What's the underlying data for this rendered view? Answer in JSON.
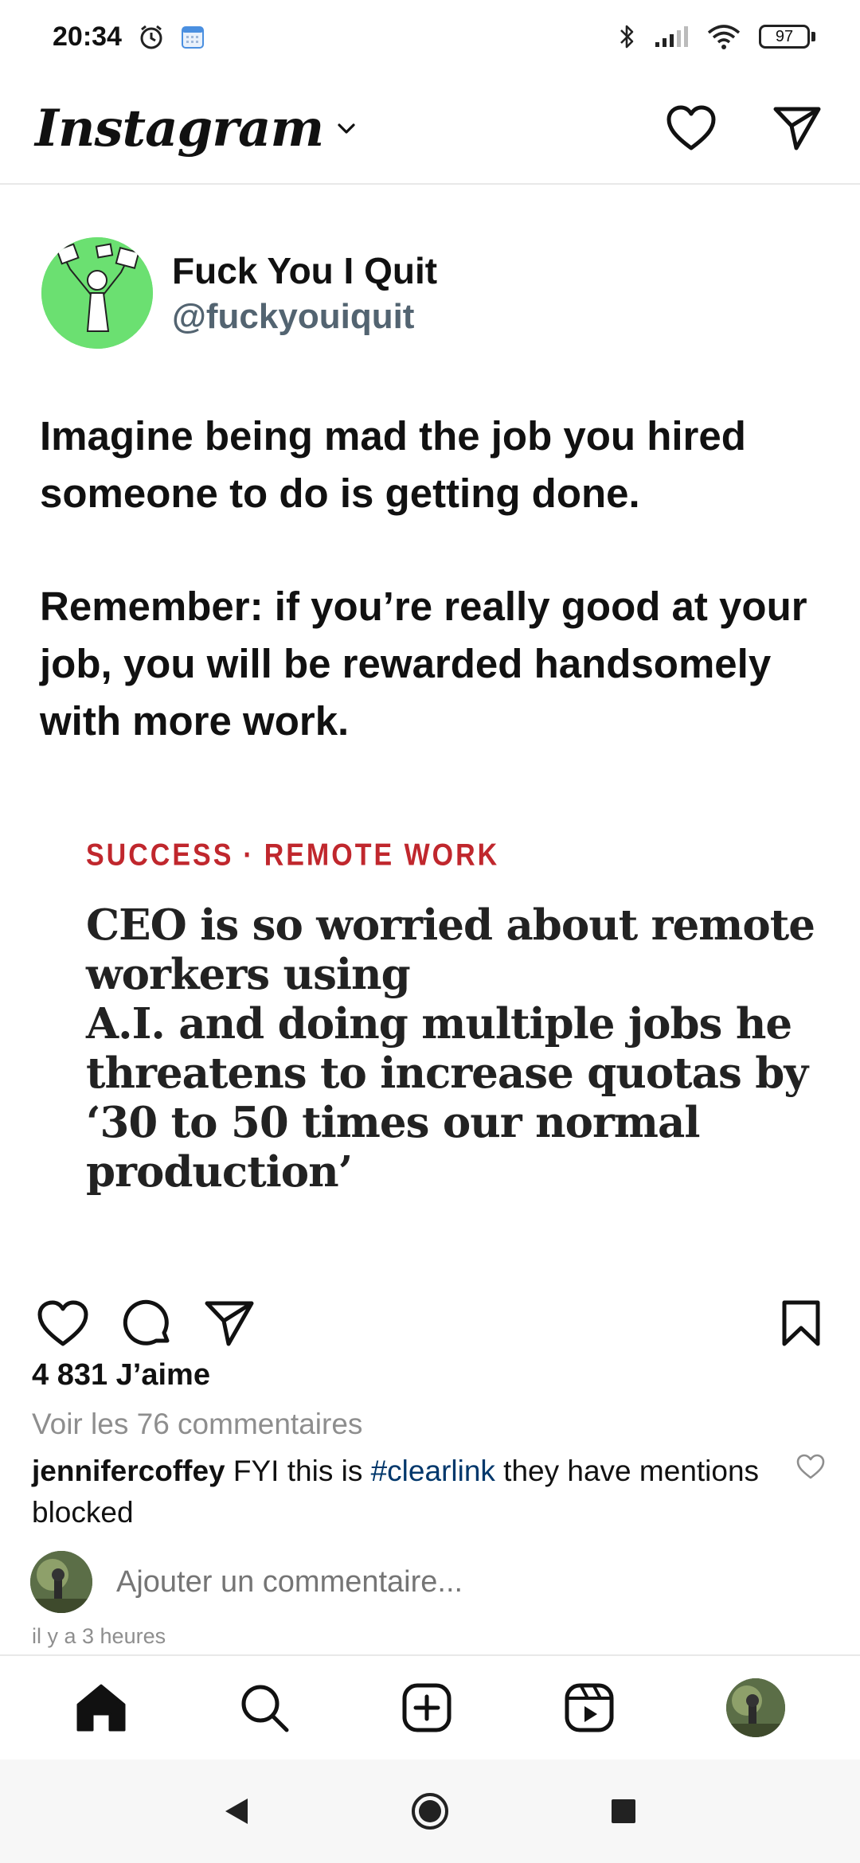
{
  "status_bar": {
    "time": "20:34",
    "battery": "97",
    "icons": [
      "alarm-icon",
      "calendar-icon",
      "bluetooth-icon",
      "signal-icon",
      "wifi-icon",
      "battery-icon"
    ]
  },
  "top_bar": {
    "logo": "Instagram",
    "icons": [
      "chevron-down-icon",
      "heart-icon",
      "send-icon"
    ]
  },
  "post": {
    "author_name": "Fuck You I Quit",
    "author_handle": "@fuckyouiquit",
    "paragraph_1": "Imagine being mad the job you hired someone to do is getting done.",
    "paragraph_2": "Remember: if you’re really good at your job, you will be rewarded handsomely with more work.",
    "article": {
      "kicker_1": "SUCCESS",
      "kicker_sep": "·",
      "kicker_2": "REMOTE WORK",
      "headline": "CEO is so worried about remote workers using\nA.I. and doing multiple jobs he threatens to increase quotas by ‘30 to 50 times our normal production’"
    }
  },
  "engagement": {
    "likes": "4 831 J’aime",
    "view_comments": "Voir les 76 commentaires",
    "comment_user": "jennifercoffey",
    "comment_pre": " FYI this is ",
    "comment_tag": "#clearlink",
    "comment_post": " they have mentions blocked",
    "add_comment_placeholder": "Ajouter un commentaire...",
    "timestamp": "il y a 3 heures"
  },
  "bottom_nav": [
    "home-icon",
    "search-icon",
    "create-icon",
    "reels-icon",
    "profile-avatar"
  ],
  "system_nav": [
    "back-icon",
    "home-button-icon",
    "recents-icon"
  ],
  "colors": {
    "avatar_green": "#6be071",
    "handle_gray": "#536471",
    "kicker_red": "#c0272d",
    "hashtag_blue": "#00376b",
    "muted_gray": "#8e8e8e"
  }
}
